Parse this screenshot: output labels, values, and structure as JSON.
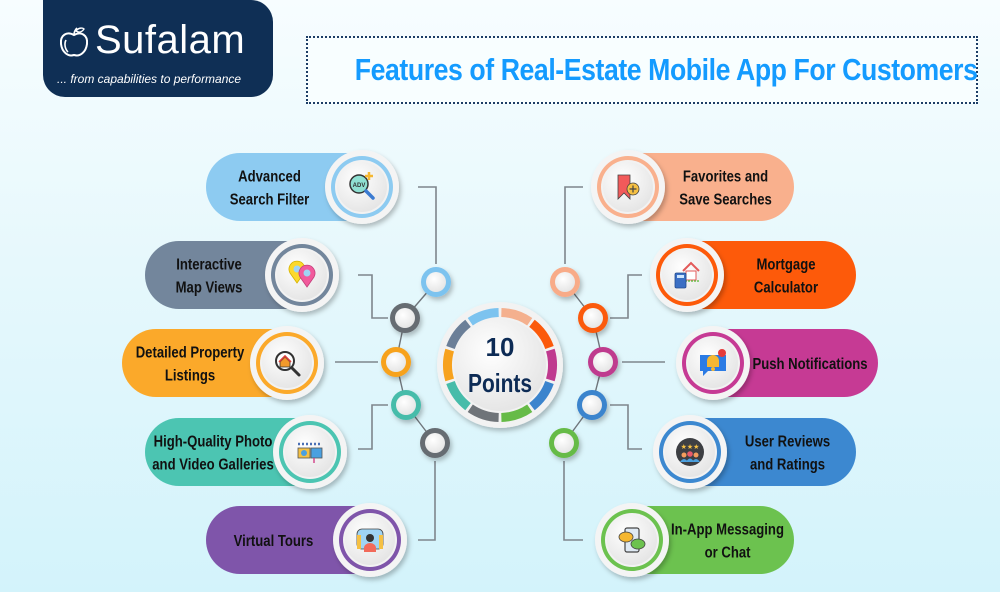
{
  "logo": {
    "brand": "Sufalam",
    "tagline": "... from capabilities to performance",
    "icon": "apple-icon",
    "color": "#0f2f55"
  },
  "title": "Features of Real-Estate Mobile App For Customers",
  "center": {
    "line1": "10",
    "line2": "Points"
  },
  "features_left": [
    {
      "lines": [
        "Advanced",
        "Search Filter"
      ],
      "color": "#8dcbf1",
      "ring": "#7cc3ef",
      "icon": "adv-search-magnifier-icon"
    },
    {
      "lines": [
        "Interactive",
        "Map Views"
      ],
      "color": "#73869c",
      "ring": "#666c72",
      "icon": "map-pins-icon"
    },
    {
      "lines": [
        "Detailed Property",
        "Listings"
      ],
      "color": "#fba92a",
      "ring": "#f7a21e",
      "icon": "house-magnifier-icon"
    },
    {
      "lines": [
        "High-Quality Photo",
        "and Video Galleries"
      ],
      "color": "#4cc5b2",
      "ring": "#47bcaa",
      "icon": "camera-gallery-icon"
    },
    {
      "lines": [
        "Virtual Tours"
      ],
      "color": "#7f55aa",
      "ring": "#6c6f74",
      "icon": "vr-tour-icon"
    }
  ],
  "features_right": [
    {
      "lines": [
        "Favorites and",
        "Save Searches"
      ],
      "color": "#f9b08d",
      "ring": "#f8ab88",
      "icon": "bookmark-plus-icon"
    },
    {
      "lines": [
        "Mortgage",
        "Calculator"
      ],
      "color": "#fd5a0a",
      "ring": "#fb5a0b",
      "icon": "calculator-house-icon"
    },
    {
      "lines": [
        "Push Notifications"
      ],
      "color": "#c63a94",
      "ring": "#bf3a8e",
      "icon": "bell-notification-icon"
    },
    {
      "lines": [
        "User Reviews",
        "and Ratings"
      ],
      "color": "#3c88d0",
      "ring": "#3b84cd",
      "icon": "star-rating-users-icon"
    },
    {
      "lines": [
        "In-App Messaging",
        "or Chat"
      ],
      "color": "#6cc24f",
      "ring": "#66bb47",
      "icon": "chat-phone-icon"
    }
  ]
}
